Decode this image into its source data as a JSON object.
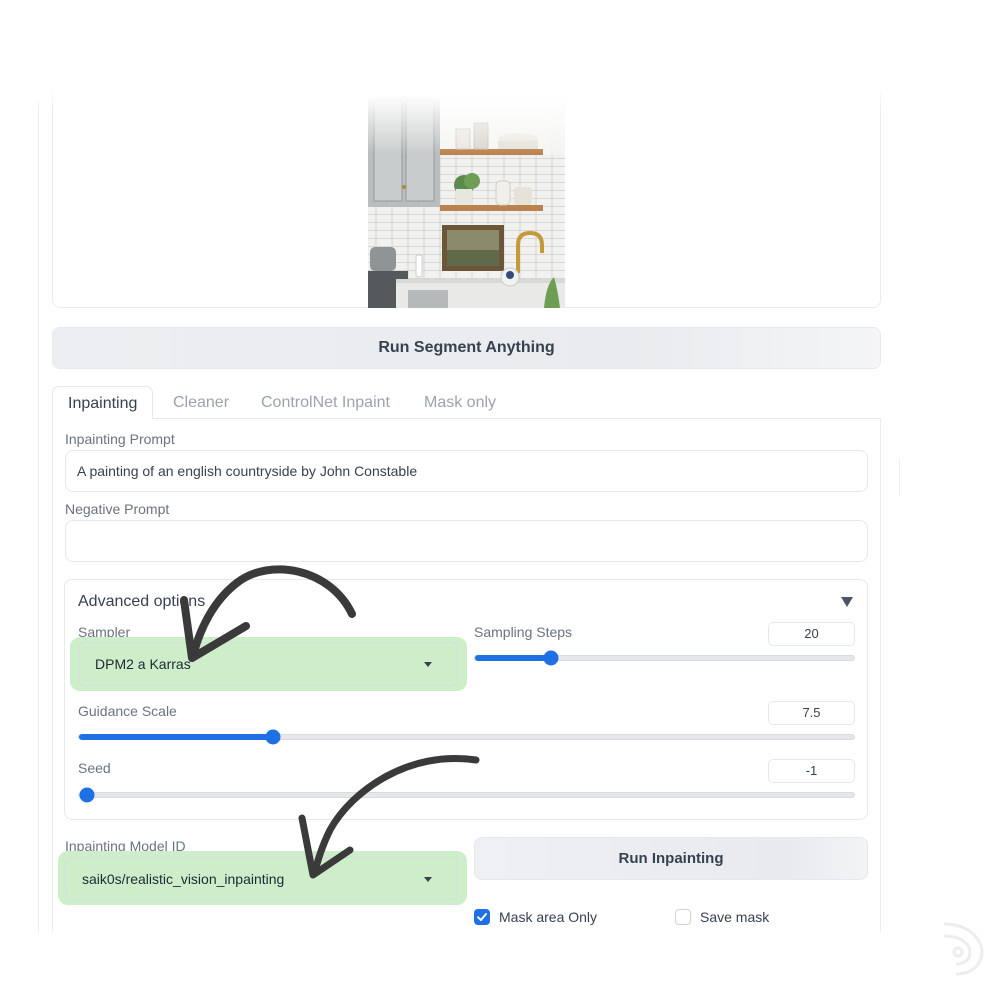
{
  "segment": {
    "button_label": "Run Segment Anything"
  },
  "tabs": [
    {
      "label": "Inpainting",
      "active": true
    },
    {
      "label": "Cleaner",
      "active": false
    },
    {
      "label": "ControlNet Inpaint",
      "active": false
    },
    {
      "label": "Mask only",
      "active": false
    }
  ],
  "inpainting": {
    "prompt_label": "Inpainting Prompt",
    "prompt_value": "A painting of an english countryside by John Constable",
    "negative_label": "Negative Prompt",
    "negative_value": ""
  },
  "advanced": {
    "title": "Advanced options",
    "sampler_label": "Sampler",
    "sampler_value": "DPM2 a Karras",
    "steps_label": "Sampling Steps",
    "steps_value": "20",
    "steps_fraction": 0.2,
    "guidance_label": "Guidance Scale",
    "guidance_value": "7.5",
    "guidance_fraction": 0.25,
    "seed_label": "Seed",
    "seed_value": "-1",
    "seed_fraction": 0.0
  },
  "model": {
    "label": "Inpainting Model ID",
    "value": "saik0s/realistic_vision_inpainting"
  },
  "run": {
    "button_label": "Run Inpainting"
  },
  "options": {
    "mask_area_label": "Mask area Only",
    "mask_area_checked": true,
    "save_mask_label": "Save mask",
    "save_mask_checked": false
  },
  "colors": {
    "accent": "#1f6fe5",
    "highlight": "#cdeec8",
    "arrow": "#3a3a3a"
  },
  "icons": {
    "collapse": "triangle-down-icon",
    "dropdown": "caret-down-icon",
    "check": "checkmark-icon"
  }
}
